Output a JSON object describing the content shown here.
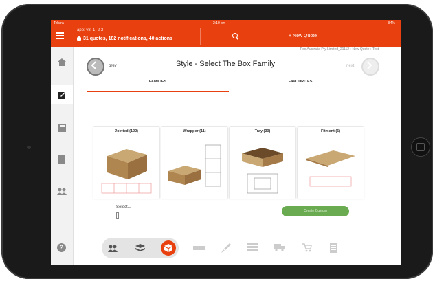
{
  "status_bar": {
    "carrier": "Telstra",
    "time": "2:10 pm",
    "battery": "84%"
  },
  "header": {
    "app_name": "app: v8_1_2-2",
    "notifications": "31 quotes, 182 notifications, 40 actions",
    "new_quote_label": "New Quote",
    "breadcrumb": "Pox Australia Pty Limited_21112 › New Quote › Test"
  },
  "page": {
    "title": "Style - Select The Box Family",
    "prev_label": "prev",
    "next_label": "next"
  },
  "tabs": [
    {
      "label": "FAMILIES",
      "active": true
    },
    {
      "label": "FAVOURITES",
      "active": false
    }
  ],
  "families": [
    {
      "label": "Jointed (122)"
    },
    {
      "label": "Wrapper (11)"
    },
    {
      "label": "Tray (30)"
    },
    {
      "label": "Fitment (5)"
    }
  ],
  "select_label": "Select...",
  "create_button": "Create Custom",
  "help_label": "?",
  "sidebar_icons": [
    "home-icon",
    "edit-icon",
    "calculator-icon",
    "list-icon",
    "users-icon"
  ],
  "bottom_icons": [
    "group-icon",
    "layers-icon",
    "box-icon"
  ],
  "tool_icons": [
    "ruler-icon",
    "brush-icon",
    "stack-icon",
    "truck-icon",
    "cart-icon",
    "document-icon"
  ],
  "colors": {
    "accent": "#e8400f",
    "create_button": "#6aaa50"
  }
}
